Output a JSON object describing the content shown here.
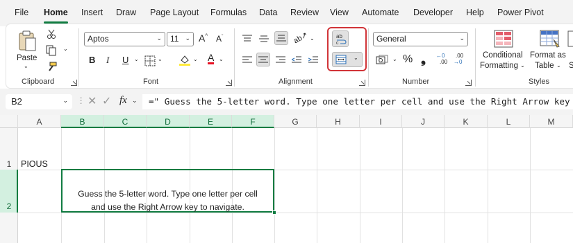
{
  "menu": {
    "tabs": [
      "File",
      "Home",
      "Insert",
      "Draw",
      "Page Layout",
      "Formulas",
      "Data",
      "Review",
      "View",
      "Automate",
      "Developer",
      "Help",
      "Power Pivot"
    ],
    "active": "Home"
  },
  "ribbon": {
    "clipboard": {
      "paste_label": "Paste",
      "group_label": "Clipboard"
    },
    "font": {
      "font_name": "Aptos",
      "font_size": "11",
      "bold": "B",
      "italic": "I",
      "underline": "U",
      "grow": "A",
      "shrink": "A",
      "font_color_glyph": "A",
      "group_label": "Font"
    },
    "alignment": {
      "group_label": "Alignment",
      "wrap_text_icon": "ab-wrap-icon"
    },
    "number": {
      "format": "General",
      "percent": "%",
      "comma": "❟",
      "inc_decimal": ".00",
      "dec_decimal": ".00",
      "group_label": "Number"
    },
    "styles": {
      "conditional_line1": "Conditional",
      "conditional_line2": "Formatting",
      "format_as_line1": "Format as",
      "format_as_line2": "Table",
      "group_label": "Styles"
    }
  },
  "formula_bar": {
    "name_box": "B2",
    "fx": "fx",
    "formula": "=\" Guess the 5-letter word. Type one letter per cell and use the Right Arrow key"
  },
  "sheet": {
    "columns": [
      "A",
      "B",
      "C",
      "D",
      "E",
      "F",
      "G",
      "H",
      "I",
      "J",
      "K",
      "L",
      "M"
    ],
    "rows": [
      "1",
      "2"
    ],
    "cells": {
      "A1": "PIOUS",
      "B2_line1": "Guess the 5-letter word. Type one letter per cell",
      "B2_line2": "and use the Right Arrow key to navigate."
    }
  },
  "colors": {
    "excel_green": "#107c41",
    "highlight_red": "#d13438"
  }
}
